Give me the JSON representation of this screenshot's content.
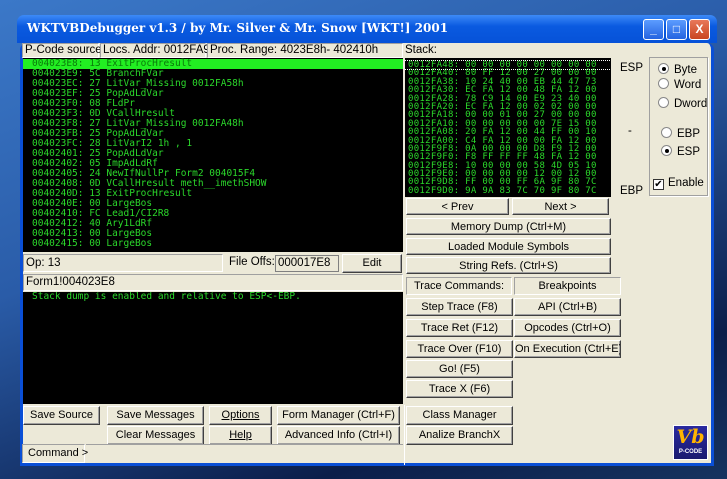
{
  "window": {
    "title": "WKTVBDebugger v1.3 / by Mr. Silver & Mr. Snow [WKT!] 2001"
  },
  "header": {
    "pcode_source": "P-Code source:",
    "locs_addr": "Locs. Addr: 0012FA94h",
    "proc_range": "Proc. Range:   4023E8h- 402410h",
    "stack": "Stack:"
  },
  "code_lines": [
    "004023E8: 13 ExitProcHresult",
    "004023E9: 5C BranchFVar",
    "004023EC: 27 LitVar_Missing 0012FA58h",
    "004023EF: 25 PopAdLdVar",
    "004023F0: 08 FLdPr",
    "004023F3: 0D VCallHresult",
    "004023F8: 27 LitVar_Missing 0012FA48h",
    "004023FB: 25 PopAdLdVar",
    "004023FC: 28 LitVarI2 1h , 1",
    "00402401: 25 PopAdLdVar",
    "00402402: 05 ImpAdLdRf",
    "00402405: 24 NewIfNullPr Form2 004015F4",
    "00402408: 0D VCallHresult meth__imethSHOW",
    "0040240D: 13 ExitProcHresult",
    "0040240E: 00 LargeBos",
    "00402410: FC Lead1/CI2R8",
    "00402412: 40 Ary1LdRf",
    "00402413: 00 LargeBos",
    "00402415: 00 LargeBos"
  ],
  "stack_lines": [
    "0012FA48: 00 00 00 00 00 00 00 00",
    "0012FA40: 80 FF 12 00 27 00 00 00",
    "0012FA38: 10 24 40 00 EB 44 47 73",
    "0012FA30: EC FA 12 00 48 FA 12 00",
    "0012FA28: 78 C9 14 00 E9 23 40 00",
    "0012FA20: EC FA 12 00 02 02 00 00",
    "0012FA18: 00 00 01 00 27 00 00 00",
    "0012FA10: 00 00 00 00 00 7E 15 00",
    "0012FA08: 20 FA 12 00 44 FF 00 10",
    "0012FA00: C4 FA 12 00 00 FA 12 00",
    "0012F9F8: 0A 00 00 00 D8 F9 12 00",
    "0012F9F0: F8 FF FF FF 48 FA 12 00",
    "0012F9E8: 10 00 00 00 58 4D 05 10",
    "0012F9E0: 00 00 00 00 12 00 12 00",
    "0012F9D8: FF 00 00 FF 6A 9F 80 7C",
    "0012F9D0: 9A 9A 83 7C 70 9F 80 7C"
  ],
  "info": {
    "op": "Op: 13",
    "file_offs_label": "File Offs:",
    "file_offs_value": "000017E8",
    "edit": "Edit",
    "location": "Form1!004023E8"
  },
  "messages": [
    "Stack dump is enabled and relative to ESP<-EBP."
  ],
  "stack_labels": {
    "esp": "ESP",
    "mid": "-",
    "ebp": "EBP"
  },
  "options": {
    "byte": "Byte",
    "word": "Word",
    "dword": "Dword",
    "ebp": "EBP",
    "esp": "ESP",
    "enable": "Enable",
    "size_selected": "Byte",
    "base_selected": "ESP",
    "enable_checked": true
  },
  "buttons": {
    "prev": "< Prev",
    "next": "Next >",
    "memory_dump": "Memory Dump (Ctrl+M)",
    "loaded_modules": "Loaded Module Symbols",
    "string_refs": "String Refs. (Ctrl+S)",
    "trace_commands": "Trace Commands:",
    "breakpoints": "Breakpoints",
    "step_trace": "Step Trace (F8)",
    "api": "API (Ctrl+B)",
    "trace_ret": "Trace Ret (F12)",
    "opcodes": "Opcodes (Ctrl+O)",
    "trace_over": "Trace Over (F10)",
    "on_execution": "On Execution (Ctrl+E)",
    "go": "Go! (F5)",
    "trace_x": "Trace X (F6)",
    "save_source": "Save Source",
    "save_messages": "Save Messages",
    "options": "Options",
    "form_manager": "Form Manager (Ctrl+F)",
    "class_manager": "Class Manager",
    "clear_messages": "Clear Messages",
    "help": "Help",
    "advanced_info": "Advanced Info (Ctrl+I)",
    "analize_branchx": "Analize BranchX",
    "command": "Command >"
  },
  "logo": {
    "text": "Vb",
    "sub": "P-CODE"
  },
  "colors": {
    "code_fg": "#2bd82b",
    "highlight": "#22ee22",
    "title_bar": "#0a5ae0"
  }
}
